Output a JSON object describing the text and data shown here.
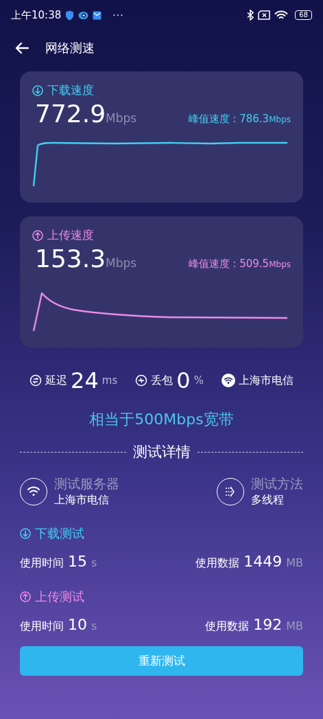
{
  "status_bar": {
    "time": "上午10:38",
    "more": "···",
    "battery": "68"
  },
  "header": {
    "title": "网络测速"
  },
  "speed_cards": [
    {
      "kind": "download",
      "title": "下载速度",
      "value": "772.9",
      "unit": "Mbps",
      "peak_text": "峰值速度 : 786.3",
      "peak_unit": "Mbps",
      "color": "#3fd0f0"
    },
    {
      "kind": "upload",
      "title": "上传速度",
      "value": "153.3",
      "unit": "Mbps",
      "peak_text": "峰值速度 : 509.5",
      "peak_unit": "Mbps",
      "color": "#ea8be8"
    }
  ],
  "stats": [
    {
      "kind": "latency",
      "label": "延迟",
      "value": "24",
      "unit": "ms"
    },
    {
      "kind": "loss",
      "label": "丢包",
      "value": "0",
      "unit": "%"
    },
    {
      "kind": "network",
      "label": "上海市电信"
    }
  ],
  "equivalent": "相当于500Mbps宽带",
  "details": {
    "title": "测试详情",
    "info": [
      {
        "kind": "server",
        "label": "测试服务器",
        "value": "上海市电信"
      },
      {
        "kind": "method",
        "label": "测试方法",
        "value": "多线程"
      }
    ],
    "tests": [
      {
        "kind": "download",
        "title": "下载测试",
        "color": "#3fd0f0",
        "time_label": "使用时间",
        "time_value": "15",
        "time_unit": "s",
        "data_label": "使用数据",
        "data_value": "1449",
        "data_unit": "MB"
      },
      {
        "kind": "upload",
        "title": "上传测试",
        "color": "#ea8be8",
        "time_label": "使用时间",
        "time_value": "10",
        "time_unit": "s",
        "data_label": "使用数据",
        "data_value": "192",
        "data_unit": "MB"
      }
    ]
  },
  "retest_button": "重新测试"
}
